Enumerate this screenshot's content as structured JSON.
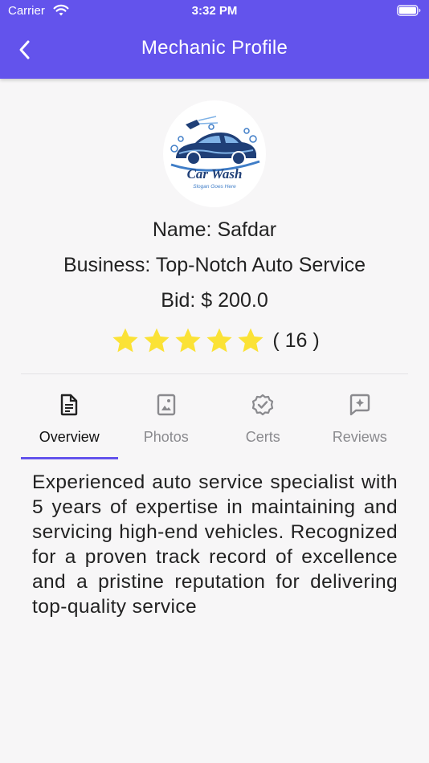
{
  "status_bar": {
    "carrier": "Carrier",
    "time": "3:32 PM"
  },
  "app_bar": {
    "title": "Mechanic Profile",
    "back_icon": "chevron-left-icon"
  },
  "profile": {
    "logo": {
      "title": "Car Wash",
      "slogan": "Slogan Goes Here"
    },
    "name_line": "Name: Safdar",
    "business_line": "Business: Top-Notch Auto Service",
    "bid_line": "Bid: $ 200.0",
    "rating": {
      "stars": 5,
      "max_stars": 5,
      "count_text": "( 16 )",
      "star_color": "#fbe236"
    }
  },
  "tabs": [
    {
      "label": "Overview",
      "icon": "document-icon",
      "active": true
    },
    {
      "label": "Photos",
      "icon": "photo-icon",
      "active": false
    },
    {
      "label": "Certs",
      "icon": "badge-check-icon",
      "active": false
    },
    {
      "label": "Reviews",
      "icon": "review-icon",
      "active": false
    }
  ],
  "overview": {
    "text": "Experienced auto service specialist with 5 years of expertise in maintaining and servicing high-end vehicles. Recognized for a proven track record of excellence and a pristine reputation for delivering top-quality service"
  },
  "colors": {
    "accent": "#6353ec",
    "background": "#f7f6f7",
    "inactive_tab": "#8a8a8e"
  }
}
